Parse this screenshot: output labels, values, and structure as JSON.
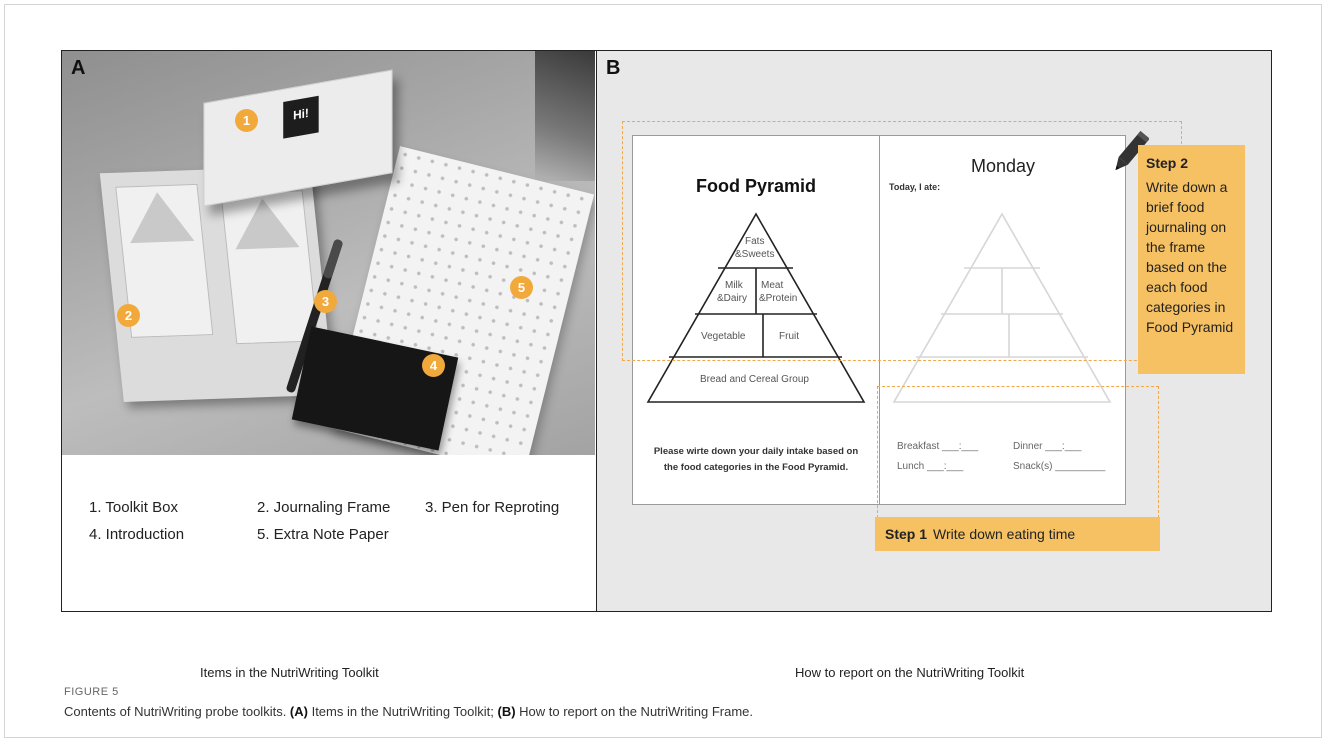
{
  "panel_a": {
    "letter": "A",
    "box_label": "Hi!",
    "badges": [
      "1",
      "2",
      "3",
      "4",
      "5"
    ],
    "legend": {
      "item1": "1. Toolkit Box",
      "item2": "2. Journaling Frame",
      "item3": "3. Pen for Reproting",
      "item4": "4. Introduction",
      "item5": "5. Extra Note Paper"
    },
    "caption": "Items in the NutriWriting Toolkit"
  },
  "panel_b": {
    "letter": "B",
    "left_page": {
      "title": "Food Pyramid",
      "tiers": {
        "fats": "Fats",
        "sweets": "&Sweets",
        "milk": "Milk",
        "dairy": "&Dairy",
        "meat": "Meat",
        "protein": "&Protein",
        "vegetable": "Vegetable",
        "fruit": "Fruit",
        "bread": "Bread and Cereal Group"
      },
      "note_line1": "Please wirte down your daily intake based on",
      "note_line2": "the food categories in the Food Pyramid."
    },
    "right_page": {
      "day": "Monday",
      "today_label": "Today, I ate:",
      "breakfast": "Breakfast ___:___",
      "dinner": "Dinner ___:___",
      "lunch": "Lunch ___:___",
      "snacks": "Snack(s) _________"
    },
    "step2": {
      "title": "Step 2",
      "text": "Write down a brief food journaling on the frame based on the each food categories in Food Pyramid"
    },
    "step1": {
      "label": "Step 1",
      "text": "Write down eating time"
    },
    "caption": "How to report on the NutriWriting Toolkit"
  },
  "figure": {
    "label": "FIGURE 5",
    "caption_start": "Contents of NutriWriting probe toolkits. ",
    "caption_a_ref": "(A)",
    "caption_a_text": " Items in the NutriWriting Toolkit; ",
    "caption_b_ref": "(B)",
    "caption_b_text": " How to report on the NutriWriting Frame."
  },
  "colors": {
    "badge": "#f2a93b",
    "step_fill": "#f5c163",
    "dash": "#f0a84a",
    "panel_b_bg": "#e8e8e8"
  }
}
